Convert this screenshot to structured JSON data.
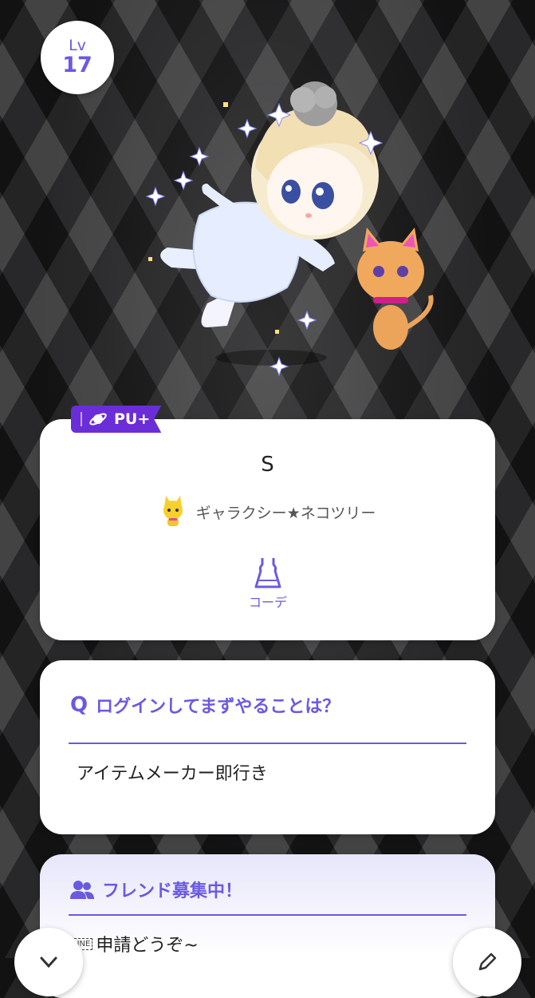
{
  "level": {
    "label": "Lv",
    "value": "17"
  },
  "badge": {
    "text": "PU+"
  },
  "profile": {
    "name": "S",
    "pet_name": "ギャラクシー★ネコツリー",
    "coordinate_label": "コーデ"
  },
  "qa": {
    "q_mark": "Q",
    "question": "ログインしてまずやることは？",
    "answer": "アイテムメーカー即行き"
  },
  "friend": {
    "title": "フレンド募集中！",
    "line_glyph": "LINE",
    "text": "申請どうぞ~"
  },
  "colors": {
    "accent": "#6a5ae0",
    "badge": "#6a2dd8"
  }
}
